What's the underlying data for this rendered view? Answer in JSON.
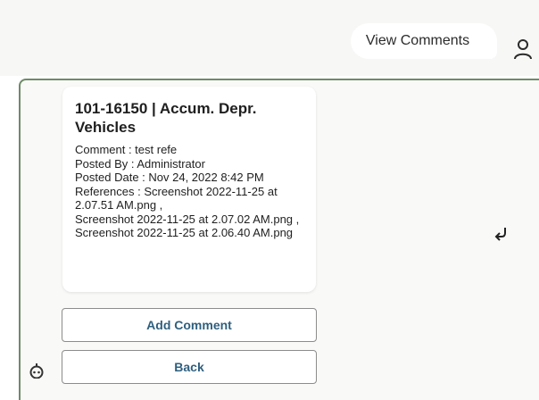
{
  "header": {
    "view_comments_label": "View Comments",
    "user_icon": "user-icon"
  },
  "comment": {
    "title": "101-16150 | Accum. Depr. Vehicles",
    "comment_line": "Comment : test refe",
    "posted_by_line": "Posted By : Administrator",
    "posted_date_line": "Posted Date : Nov 24, 2022 8:42 PM",
    "references_line": "References :  Screenshot 2022-11-25 at 2.07.51 AM.png ,",
    "reference_2": "Screenshot 2022-11-25 at 2.07.02 AM.png ,",
    "reference_3": "Screenshot 2022-11-25 at 2.06.40 AM.png"
  },
  "actions": {
    "add_comment_label": "Add Comment",
    "back_label": "Back"
  },
  "icons": {
    "undo": "undo-icon",
    "assistant": "assistant-icon"
  },
  "colors": {
    "panel_border": "#6f8a68",
    "button_text": "#2f5f7e",
    "topbar_bg": "#f7f7f6"
  }
}
